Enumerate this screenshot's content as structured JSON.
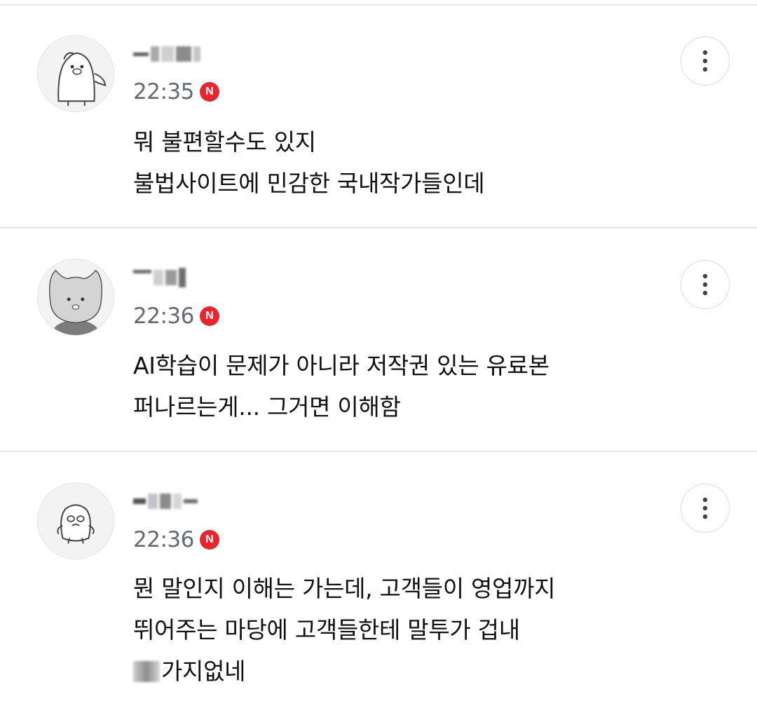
{
  "comments": [
    {
      "time": "22:35",
      "badge": "N",
      "line1": "뭐 불편할수도 있지",
      "line2": "불법사이트에 민감한 국내작가들인데",
      "avatar_icon": "penguin-avatar-icon"
    },
    {
      "time": "22:36",
      "badge": "N",
      "line1": "AI학습이 문제가 아니라 저작권 있는 유료본",
      "line2": "퍼나르는게... 그거면 이해함",
      "avatar_icon": "cat-avatar-icon"
    },
    {
      "time": "22:36",
      "badge": "N",
      "line1": "뭔 말인지 이해는 가는데, 고객들이 영업까지",
      "line2": "뛰어주는 마당에 고객들한테 말투가 겁내",
      "line3_suffix": "가지없네",
      "avatar_icon": "blob-avatar-icon"
    }
  ],
  "more_icon": "more-vertical-icon",
  "badge_color": "#e8242c",
  "time_color": "#666a73"
}
